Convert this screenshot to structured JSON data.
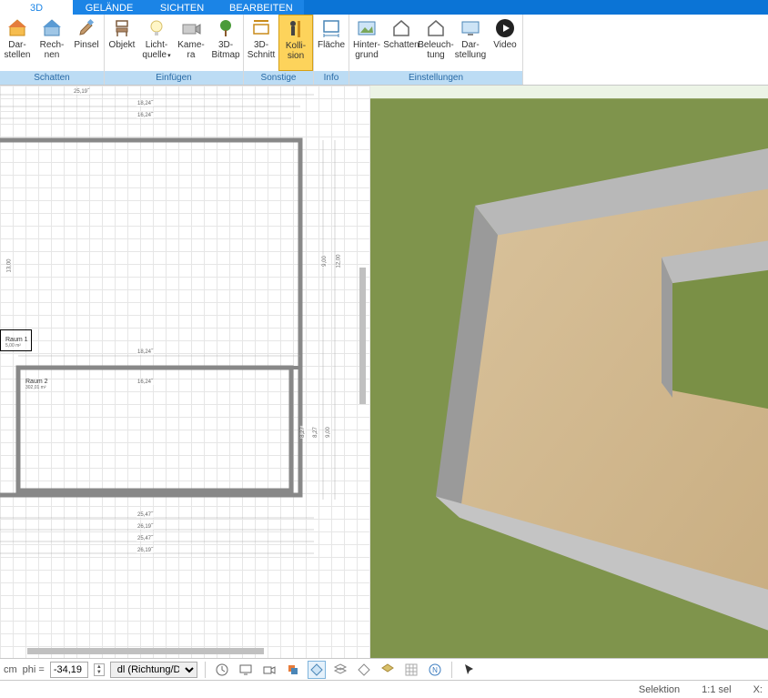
{
  "tabs": {
    "t3d": "3D",
    "gelaende": "GELÄNDE",
    "sichten": "SICHTEN",
    "bearbeiten": "BEARBEITEN"
  },
  "ribbon_groups": {
    "schatten": "Schatten",
    "einfuegen": "Einfügen",
    "sonstige": "Sonstige",
    "info": "Info",
    "einstellungen": "Einstellungen"
  },
  "ribbon": {
    "darstellen": {
      "l1": "Dar-",
      "l2": "stellen"
    },
    "rechnen": {
      "l1": "Rech-",
      "l2": "nen"
    },
    "pinsel": {
      "l1": "Pinsel",
      "l2": ""
    },
    "objekt": {
      "l1": "Objekt",
      "l2": ""
    },
    "lichtquelle": {
      "l1": "Licht-",
      "l2": "quelle"
    },
    "kamera": {
      "l1": "Kame-",
      "l2": "ra"
    },
    "bitmap": {
      "l1": "3D-",
      "l2": "Bitmap"
    },
    "schnitt": {
      "l1": "3D-",
      "l2": "Schnitt"
    },
    "kollision": {
      "l1": "Kolli-",
      "l2": "sion"
    },
    "flaeche": {
      "l1": "Fläche",
      "l2": ""
    },
    "hintergrund": {
      "l1": "Hinter-",
      "l2": "grund"
    },
    "schatten": {
      "l1": "Schatten",
      "l2": ""
    },
    "beleuchtung": {
      "l1": "Beleuch-",
      "l2": "tung"
    },
    "darstellung": {
      "l1": "Dar-",
      "l2": "stellung"
    },
    "video": {
      "l1": "Video",
      "l2": ""
    }
  },
  "plan": {
    "room1": {
      "name": "Raum 1",
      "area": "5,00 m²"
    },
    "room2": {
      "name": "Raum 2",
      "area": "302,01 m²"
    },
    "dim_2519": "25,19˝",
    "dim_1824": "18,24˝",
    "dim_1624a": "16,24˝",
    "dim_1624b": "16,24˝",
    "dim_1300": "13,00",
    "dim_1200": "12,00",
    "dim_0900": "9,00",
    "dim_827": "8,27",
    "dim_2547": "25,47˝",
    "dim_2619a": "26,19˝",
    "dim_2619b": "26,19˝",
    "dim_2547b": "25,47˝"
  },
  "bottombar": {
    "unit": "cm",
    "phi_label": "phi =",
    "phi_value": "-34,19",
    "dl_label": "dl (Richtung/Di"
  },
  "status": {
    "selektion": "Selektion",
    "scale": "1:1 sel",
    "coord": "X:"
  }
}
